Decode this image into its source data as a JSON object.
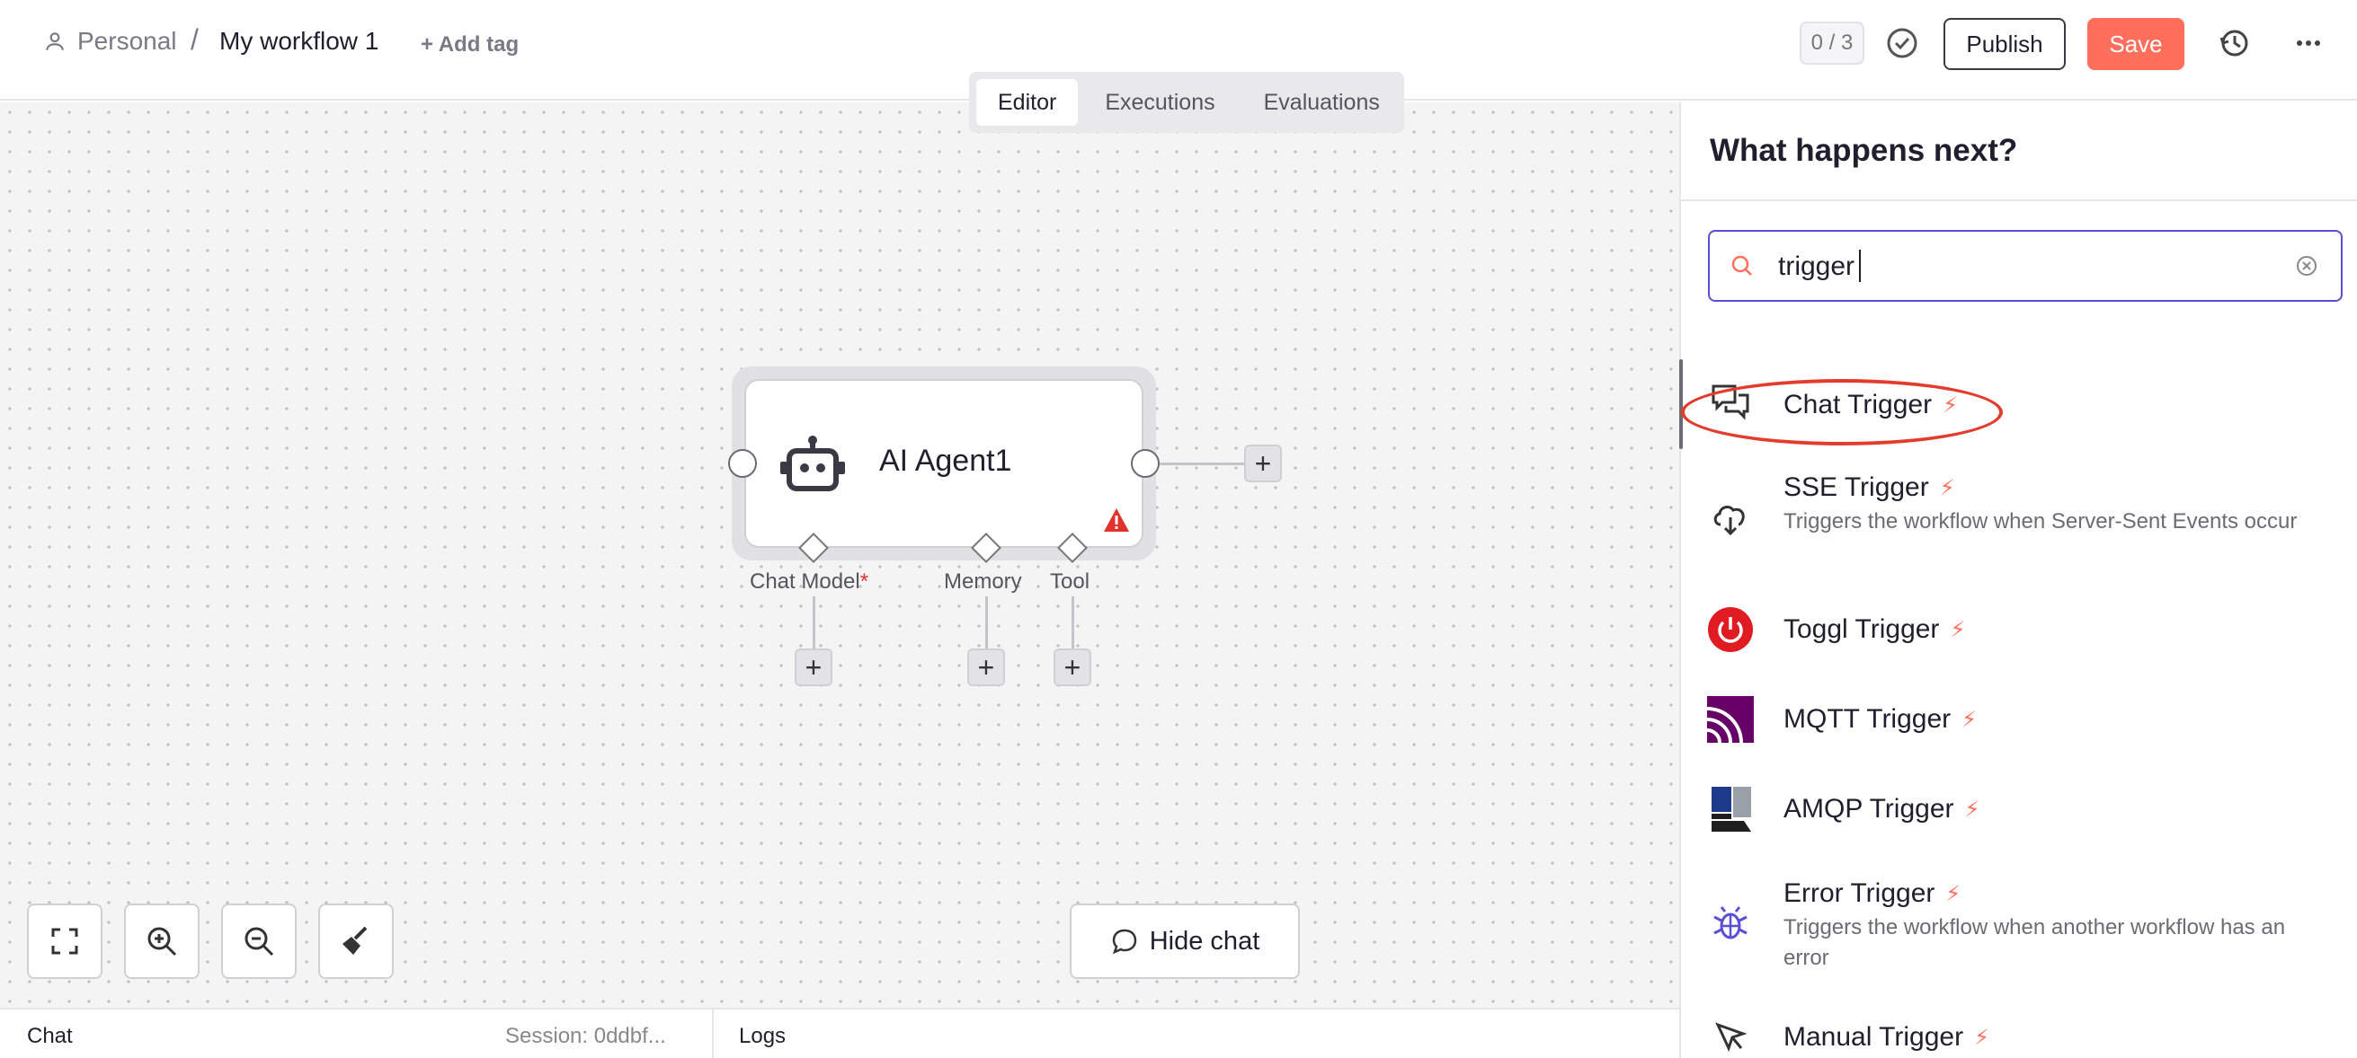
{
  "header": {
    "project": "Personal",
    "separator": "/",
    "workflow_name": "My workflow 1",
    "add_tag": "+ Add tag",
    "counter": "0 / 3",
    "publish": "Publish",
    "save": "Save"
  },
  "tabs": [
    {
      "label": "Editor",
      "active": true
    },
    {
      "label": "Executions",
      "active": false
    },
    {
      "label": "Evaluations",
      "active": false
    }
  ],
  "canvas": {
    "node": {
      "title": "AI Agent1",
      "icon": "robot-icon",
      "warning_icon": "warning-icon"
    },
    "connectors": {
      "chat_model": "Chat Model",
      "chat_model_required": "*",
      "memory": "Memory",
      "tool": "Tool"
    },
    "plus": "+",
    "hide_chat": "Hide chat"
  },
  "bottom": {
    "chat": "Chat",
    "session": "Session: 0ddbf...",
    "logs": "Logs"
  },
  "panel": {
    "title": "What happens next?",
    "search_value": "trigger",
    "items": [
      {
        "title": "Chat Trigger",
        "desc": "",
        "icon": "chat-bubbles-icon"
      },
      {
        "title": "SSE Trigger",
        "desc": "Triggers the workflow when Server-Sent Events occur",
        "icon": "cloud-download-icon"
      },
      {
        "title": "Toggl Trigger",
        "desc": "",
        "icon": "toggl-power-icon"
      },
      {
        "title": "MQTT Trigger",
        "desc": "",
        "icon": "mqtt-icon"
      },
      {
        "title": "AMQP Trigger",
        "desc": "",
        "icon": "amqp-icon"
      },
      {
        "title": "Error Trigger",
        "desc": "Triggers the workflow when another workflow has an error",
        "icon": "bug-icon"
      },
      {
        "title": "Manual Trigger",
        "desc": "",
        "icon": "cursor-icon"
      }
    ],
    "bolt": "⚡"
  },
  "colors": {
    "accent": "#ff6f5c",
    "search_border": "#5b4ed6",
    "annotation": "#e43c2c",
    "toggl": "#e01b22",
    "mqtt": "#660066",
    "bug": "#5b4ed6"
  }
}
